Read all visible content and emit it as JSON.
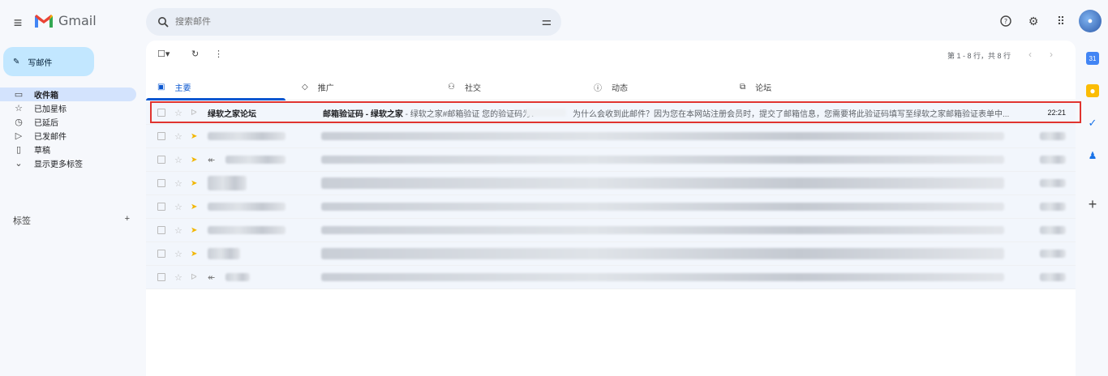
{
  "app": {
    "name": "Gmail"
  },
  "search": {
    "placeholder": "搜索邮件"
  },
  "compose": {
    "label": "写邮件"
  },
  "nav": [
    {
      "label": "收件箱",
      "icon": "inbox-icon",
      "active": true
    },
    {
      "label": "已加星标",
      "icon": "star-icon"
    },
    {
      "label": "已延后",
      "icon": "clock-icon"
    },
    {
      "label": "已发邮件",
      "icon": "send-icon"
    },
    {
      "label": "草稿",
      "icon": "draft-icon"
    },
    {
      "label": "显示更多标签",
      "icon": "chevron-down-icon"
    }
  ],
  "labels": {
    "title": "标签",
    "add": "+"
  },
  "toolbar": {
    "pager": "第 1 - 8 行，共 8 行"
  },
  "tabs": [
    {
      "label": "主要",
      "icon": "inbox-icon",
      "active": true
    },
    {
      "label": "推广",
      "icon": "tag-icon"
    },
    {
      "label": "社交",
      "icon": "people-icon"
    },
    {
      "label": "动态",
      "icon": "info-icon"
    },
    {
      "label": "论坛",
      "icon": "forum-icon"
    }
  ],
  "emails": [
    {
      "sender": "绿软之家论坛",
      "subject": "邮箱验证码 - 绿软之家",
      "snippet_a": " - 绿软之家#邮箱验证 您的验证码为：",
      "snippet_b": "为什么会收到此邮件？因为您在本网站注册会员时，提交了邮箱信息，您需要将此验证码填写至绿软之家邮箱验证表单中...",
      "time": "22:21"
    }
  ],
  "colors": {
    "accent": "#0b57d0",
    "highlight": "#e0342f",
    "compose": "#c2e7ff"
  }
}
